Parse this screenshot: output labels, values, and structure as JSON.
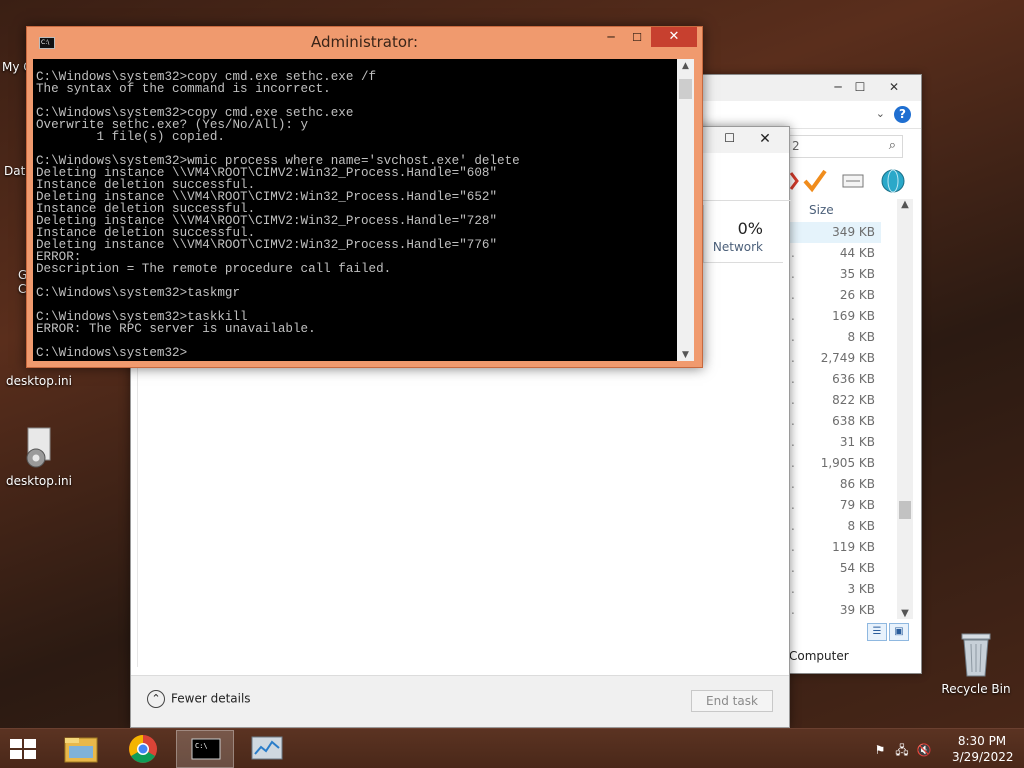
{
  "desktop": {
    "icons": [
      {
        "label": "desktop.ini"
      },
      {
        "label": "desktop.ini"
      },
      {
        "label": "Recycle Bin"
      }
    ],
    "partial_labels": [
      "My C",
      "Data",
      "G",
      "C"
    ]
  },
  "explorer": {
    "search_value": "2",
    "column_size": "Size",
    "sizes": [
      "349 KB",
      "44 KB",
      "35 KB",
      "26 KB",
      "169 KB",
      "8 KB",
      "2,749 KB",
      "636 KB",
      "822 KB",
      "638 KB",
      "31 KB",
      "1,905 KB",
      "86 KB",
      "79 KB",
      "8 KB",
      "119 KB",
      "54 KB",
      "3 KB",
      "39 KB"
    ],
    "status": "Computer"
  },
  "taskmgr": {
    "network_pct": "0%",
    "network_label": "Network",
    "fewer_details": "Fewer details",
    "end_task": "End task"
  },
  "cmd": {
    "title": "Administrator:",
    "output": "C:\\Windows\\system32>copy cmd.exe sethc.exe /f\nThe syntax of the command is incorrect.\n\nC:\\Windows\\system32>copy cmd.exe sethc.exe\nOverwrite sethc.exe? (Yes/No/All): y\n        1 file(s) copied.\n\nC:\\Windows\\system32>wmic process where name='svchost.exe' delete\nDeleting instance \\\\VM4\\ROOT\\CIMV2:Win32_Process.Handle=\"608\"\nInstance deletion successful.\nDeleting instance \\\\VM4\\ROOT\\CIMV2:Win32_Process.Handle=\"652\"\nInstance deletion successful.\nDeleting instance \\\\VM4\\ROOT\\CIMV2:Win32_Process.Handle=\"728\"\nInstance deletion successful.\nDeleting instance \\\\VM4\\ROOT\\CIMV2:Win32_Process.Handle=\"776\"\nERROR:\nDescription = The remote procedure call failed.\n\nC:\\Windows\\system32>taskmgr\n\nC:\\Windows\\system32>taskkill\nERROR: The RPC server is unavailable.\n\nC:\\Windows\\system32>"
  },
  "taskbar": {
    "time": "8:30 PM",
    "date": "3/29/2022"
  },
  "colors": {
    "accent_orange": "#f09a6e",
    "close_red": "#c7402f"
  }
}
